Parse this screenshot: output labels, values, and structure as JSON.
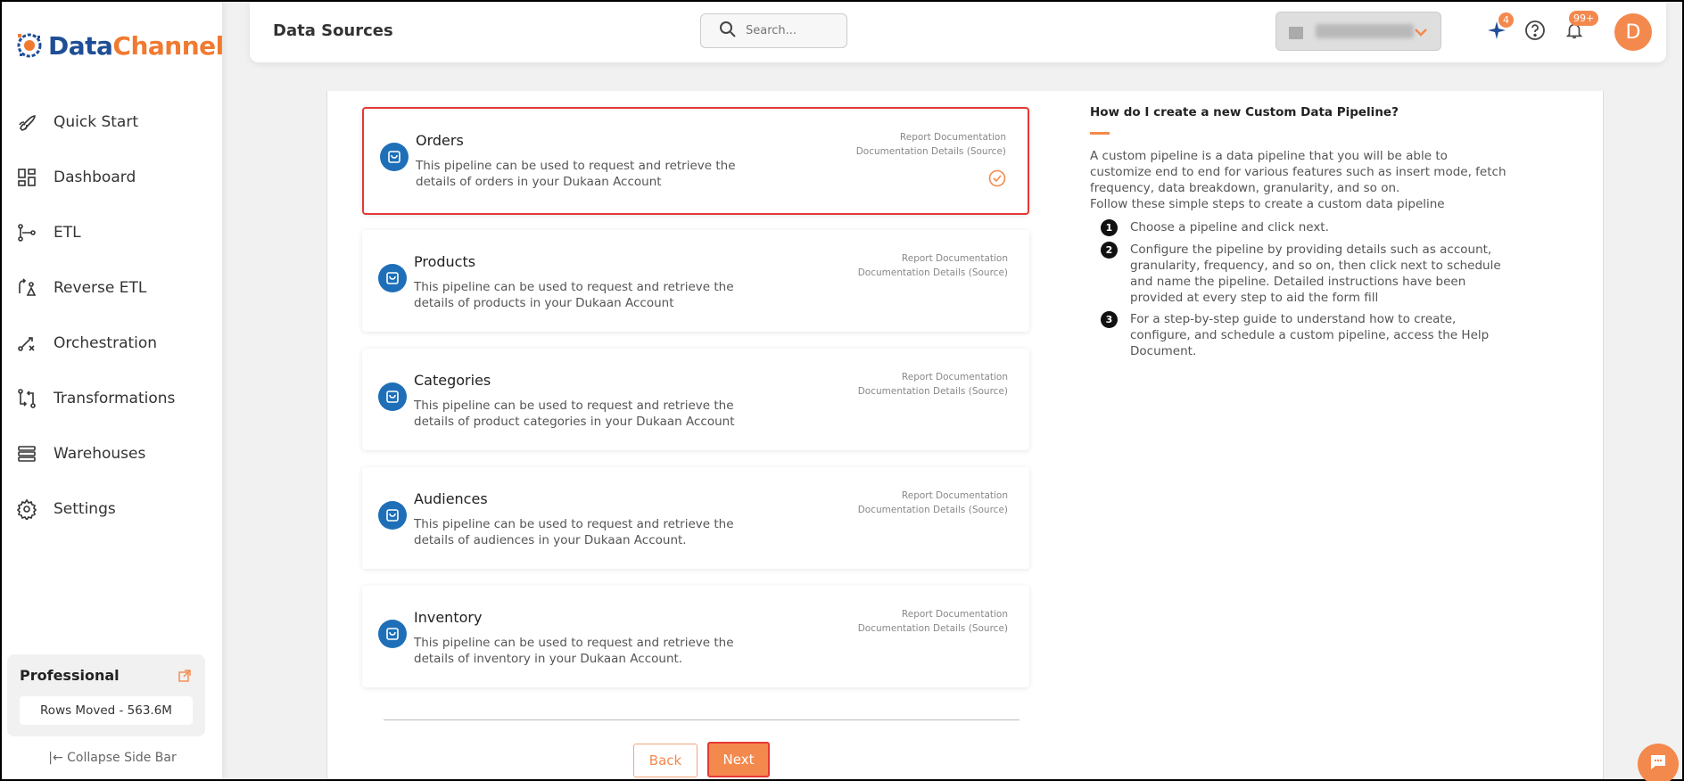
{
  "brand": {
    "name_part1": "Data",
    "name_part2": "Channel",
    "primary": "#1f4e96",
    "accent": "#f4894d"
  },
  "sidebar": {
    "items": [
      {
        "label": "Quick Start",
        "icon": "rocket-icon"
      },
      {
        "label": "Dashboard",
        "icon": "dashboard-icon"
      },
      {
        "label": "ETL",
        "icon": "etl-icon"
      },
      {
        "label": "Reverse ETL",
        "icon": "reverse-etl-icon"
      },
      {
        "label": "Orchestration",
        "icon": "orchestration-icon"
      },
      {
        "label": "Transformations",
        "icon": "transformations-icon"
      },
      {
        "label": "Warehouses",
        "icon": "warehouses-icon"
      },
      {
        "label": "Settings",
        "icon": "gear-icon"
      }
    ],
    "plan": {
      "title": "Professional",
      "rows": "Rows Moved - 563.6M"
    },
    "collapse_label": "Collapse Side Bar"
  },
  "header": {
    "title": "Data Sources",
    "search_placeholder": "Search...",
    "ai_badge": "4",
    "notif_badge": "99+",
    "avatar_initial": "D"
  },
  "cards": [
    {
      "title": "Orders",
      "desc": "This pipeline can be used to request and retrieve the details of orders in your Dukaan Account",
      "link1": "Report Documentation",
      "link2": "Documentation Details (Source)",
      "selected": true
    },
    {
      "title": "Products",
      "desc": "This pipeline can be used to request and retrieve the details of products in your Dukaan Account",
      "link1": "Report Documentation",
      "link2": "Documentation Details (Source)",
      "selected": false
    },
    {
      "title": "Categories",
      "desc": "This pipeline can be used to request and retrieve the details of product categories in your Dukaan Account",
      "link1": "Report Documentation",
      "link2": "Documentation Details (Source)",
      "selected": false
    },
    {
      "title": "Audiences",
      "desc": "This pipeline can be used to request and retrieve the details of audiences in your Dukaan Account.",
      "link1": "Report Documentation",
      "link2": "Documentation Details (Source)",
      "selected": false
    },
    {
      "title": "Inventory",
      "desc": "This pipeline can be used to request and retrieve the details of inventory in your Dukaan Account.",
      "link1": "Report Documentation",
      "link2": "Documentation Details (Source)",
      "selected": false
    }
  ],
  "buttons": {
    "back": "Back",
    "next": "Next"
  },
  "help": {
    "title": "How do I create a new Custom Data Pipeline?",
    "intro": "A custom pipeline is a data pipeline that you will be able to customize end to end for various features such as insert mode, fetch frequency, data breakdown, granularity, and so on.",
    "intro2": "Follow these simple steps to create a custom data pipeline",
    "steps": [
      {
        "num": "1",
        "text": "Choose a pipeline and click next."
      },
      {
        "num": "2",
        "text": "Configure the pipeline by providing details such as account, granularity, frequency, and so on, then click next to schedule and name the pipeline. Detailed instructions have been provided at every step to aid the form fill"
      },
      {
        "num": "3",
        "text": "For a step-by-step guide to understand how to create, configure, and schedule a custom pipeline, access the Help Document."
      }
    ]
  }
}
